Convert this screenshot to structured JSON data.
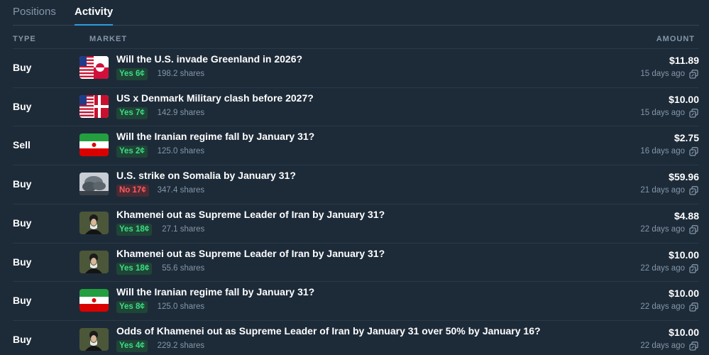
{
  "tabs": [
    {
      "label": "Positions",
      "active": false
    },
    {
      "label": "Activity",
      "active": true
    }
  ],
  "columns": {
    "type": "TYPE",
    "market": "MARKET",
    "amount": "AMOUNT"
  },
  "colors": {
    "accent": "#2d9cdb",
    "yes": "#3ddc84",
    "no": "#ff5a5f",
    "background": "#1d2b39"
  },
  "rows": [
    {
      "type": "Buy",
      "title": "Will the U.S. invade Greenland in 2026?",
      "outcome": "Yes 6¢",
      "outcome_kind": "yes",
      "shares": "198.2 shares",
      "amount": "$11.89",
      "ago": "15 days ago",
      "thumb": "us-greenland-flags"
    },
    {
      "type": "Buy",
      "title": "US x Denmark Military clash before 2027?",
      "outcome": "Yes 7¢",
      "outcome_kind": "yes",
      "shares": "142.9 shares",
      "amount": "$10.00",
      "ago": "15 days ago",
      "thumb": "us-denmark-flags"
    },
    {
      "type": "Sell",
      "title": "Will the Iranian regime fall by January 31?",
      "outcome": "Yes 2¢",
      "outcome_kind": "yes",
      "shares": "125.0 shares",
      "amount": "$2.75",
      "ago": "16 days ago",
      "thumb": "iran-flag"
    },
    {
      "type": "Buy",
      "title": "U.S. strike on Somalia by January 31?",
      "outcome": "No 17¢",
      "outcome_kind": "no",
      "shares": "347.4 shares",
      "amount": "$59.96",
      "ago": "21 days ago",
      "thumb": "smoke-photo"
    },
    {
      "type": "Buy",
      "title": "Khamenei out as Supreme Leader of Iran by January 31?",
      "outcome": "Yes 18¢",
      "outcome_kind": "yes",
      "shares": "27.1 shares",
      "amount": "$4.88",
      "ago": "22 days ago",
      "thumb": "portrait"
    },
    {
      "type": "Buy",
      "title": "Khamenei out as Supreme Leader of Iran by January 31?",
      "outcome": "Yes 18¢",
      "outcome_kind": "yes",
      "shares": "55.6 shares",
      "amount": "$10.00",
      "ago": "22 days ago",
      "thumb": "portrait"
    },
    {
      "type": "Buy",
      "title": "Will the Iranian regime fall by January 31?",
      "outcome": "Yes 8¢",
      "outcome_kind": "yes",
      "shares": "125.0 shares",
      "amount": "$10.00",
      "ago": "22 days ago",
      "thumb": "iran-flag"
    },
    {
      "type": "Buy",
      "title": "Odds of Khamenei out as Supreme Leader of Iran by January 31 over 50% by January 16?",
      "outcome": "Yes 4¢",
      "outcome_kind": "yes",
      "shares": "229.2 shares",
      "amount": "$10.00",
      "ago": "22 days ago",
      "thumb": "portrait"
    }
  ]
}
